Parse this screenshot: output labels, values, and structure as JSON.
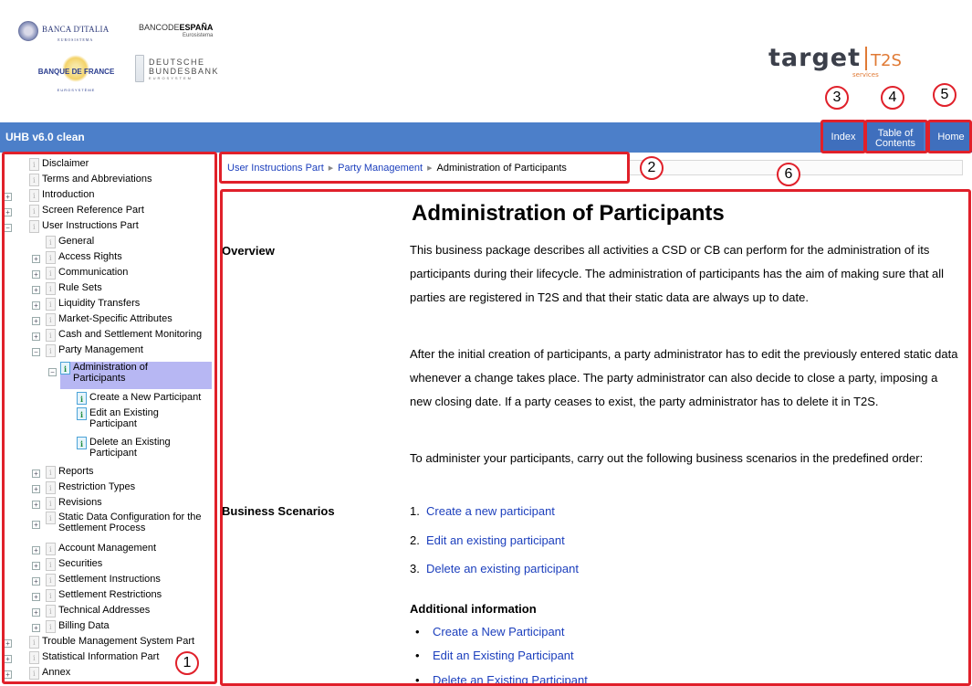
{
  "header": {
    "logos": {
      "banca_italia": "BANCA D'ITALIA",
      "banca_italia_sub": "EUROSISTEMA",
      "banco_espana_prefix": "BANCODE",
      "banco_espana_bold": "ESPAÑA",
      "banco_espana_sub": "Eurosistema",
      "banque_france": "BANQUE DE FRANCE",
      "banque_france_sub": "EUROSYSTÈME",
      "bundesbank_line1": "DEUTSCHE",
      "bundesbank_line2": "BUNDESBANK",
      "bundesbank_sub": "EUROSYSTEM",
      "target": "target",
      "target_services": "services",
      "t2s": "T2S"
    }
  },
  "topbar": {
    "title": "UHB v6.0 clean",
    "index_label": "Index",
    "toc_label": "Table of Contents",
    "home_label": "Home"
  },
  "sidebar": {
    "items": [
      {
        "label": "Disclaimer"
      },
      {
        "label": "Terms and Abbreviations"
      },
      {
        "label": "Introduction"
      },
      {
        "label": "Screen Reference Part"
      },
      {
        "label": "User Instructions Part"
      },
      {
        "label": "General"
      },
      {
        "label": "Access Rights"
      },
      {
        "label": "Communication"
      },
      {
        "label": "Rule Sets"
      },
      {
        "label": "Liquidity Transfers"
      },
      {
        "label": "Market-Specific Attributes"
      },
      {
        "label": "Cash and Settlement Monitoring"
      },
      {
        "label": "Party Management"
      },
      {
        "label": "Administration of Participants"
      },
      {
        "label": "Create a New Participant"
      },
      {
        "label": "Edit an Existing Participant"
      },
      {
        "label": "Delete an Existing Participant"
      },
      {
        "label": "Reports"
      },
      {
        "label": "Restriction Types"
      },
      {
        "label": "Revisions"
      },
      {
        "label": "Static Data Configuration for the Settlement Process"
      },
      {
        "label": "Account Management"
      },
      {
        "label": "Securities"
      },
      {
        "label": "Settlement Instructions"
      },
      {
        "label": "Settlement Restrictions"
      },
      {
        "label": "Technical Addresses"
      },
      {
        "label": "Billing Data"
      },
      {
        "label": "Trouble Management System Part"
      },
      {
        "label": "Statistical Information Part"
      },
      {
        "label": "Annex"
      }
    ]
  },
  "breadcrumb": {
    "items": [
      "User Instructions Part",
      "Party Management"
    ],
    "current": "Administration of Participants"
  },
  "content": {
    "title": "Administration of Participants",
    "overview_label": "Overview",
    "paragraphs": [
      "This business package describes all activities a CSD or CB can perform for the administration of its participants during their lifecycle. The administration of participants has the aim of making sure that all parties are registered in T2S and that their static data are always up to date.",
      "After the initial creation of participants, a party administrator has to edit the previously entered static data whenever a change takes place. The party administrator can also decide to close a party, imposing a new closing date. If a party ceases to exist, the party administrator has to delete it in T2S.",
      "To administer your participants, carry out the following business scenarios in the predefined order:"
    ],
    "business_scenarios_label": "Business Scenarios",
    "scenarios": [
      {
        "num": "1.",
        "label": "Create a new participant"
      },
      {
        "num": "2.",
        "label": "Edit an existing participant"
      },
      {
        "num": "3.",
        "label": "Delete an existing participant"
      }
    ],
    "additional_info_label": "Additional information",
    "additional_links": [
      "Create a New Participant",
      "Edit an Existing Participant",
      "Delete an Existing Participant"
    ]
  },
  "annotations": {
    "sidebar": "1",
    "breadcrumb": "2",
    "index": "3",
    "toc": "4",
    "home": "5",
    "content": "6"
  },
  "colors": {
    "topbar": "#4c7fc9",
    "annotation_red": "#e0202a",
    "link": "#1c3fbd",
    "selected": "#b7b7f3"
  }
}
